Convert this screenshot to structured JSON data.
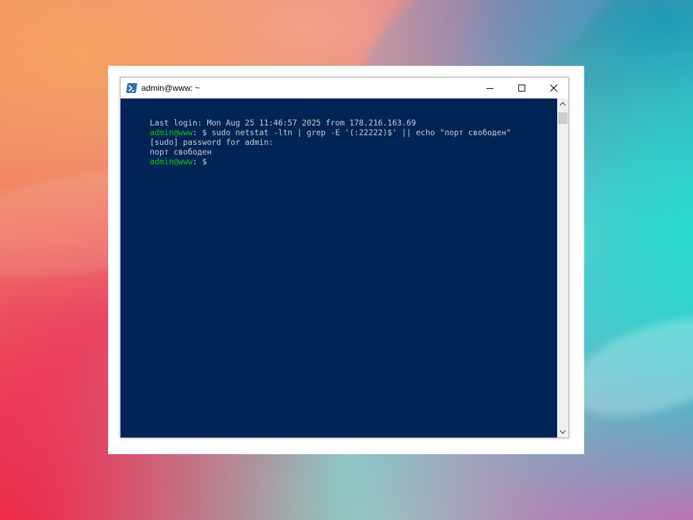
{
  "window": {
    "title": "admin@www: ~",
    "icon": "powershell-terminal-icon"
  },
  "controls": {
    "minimize_icon": "minimize-icon",
    "maximize_icon": "maximize-icon",
    "close_icon": "close-icon"
  },
  "terminal": {
    "background": "#012456",
    "prompt_color": "#16c60c",
    "text_color": "#cccccc",
    "lines": [
      {
        "text": "Last login: Mon Aug 25 11:46:57 2025 from 178.216.163.69"
      },
      {
        "user": "admin@www",
        "rest": ": $ sudo netstat -ltn | grep -E '(:22222)$' || echo \"порт свободен\""
      },
      {
        "text": "[sudo] password for admin:"
      },
      {
        "text": "порт свободен"
      },
      {
        "user": "admin@www",
        "rest": ": $ "
      }
    ]
  },
  "scrollbar": {
    "up_icon": "scroll-up-arrow-icon",
    "down_icon": "scroll-down-arrow-icon"
  }
}
